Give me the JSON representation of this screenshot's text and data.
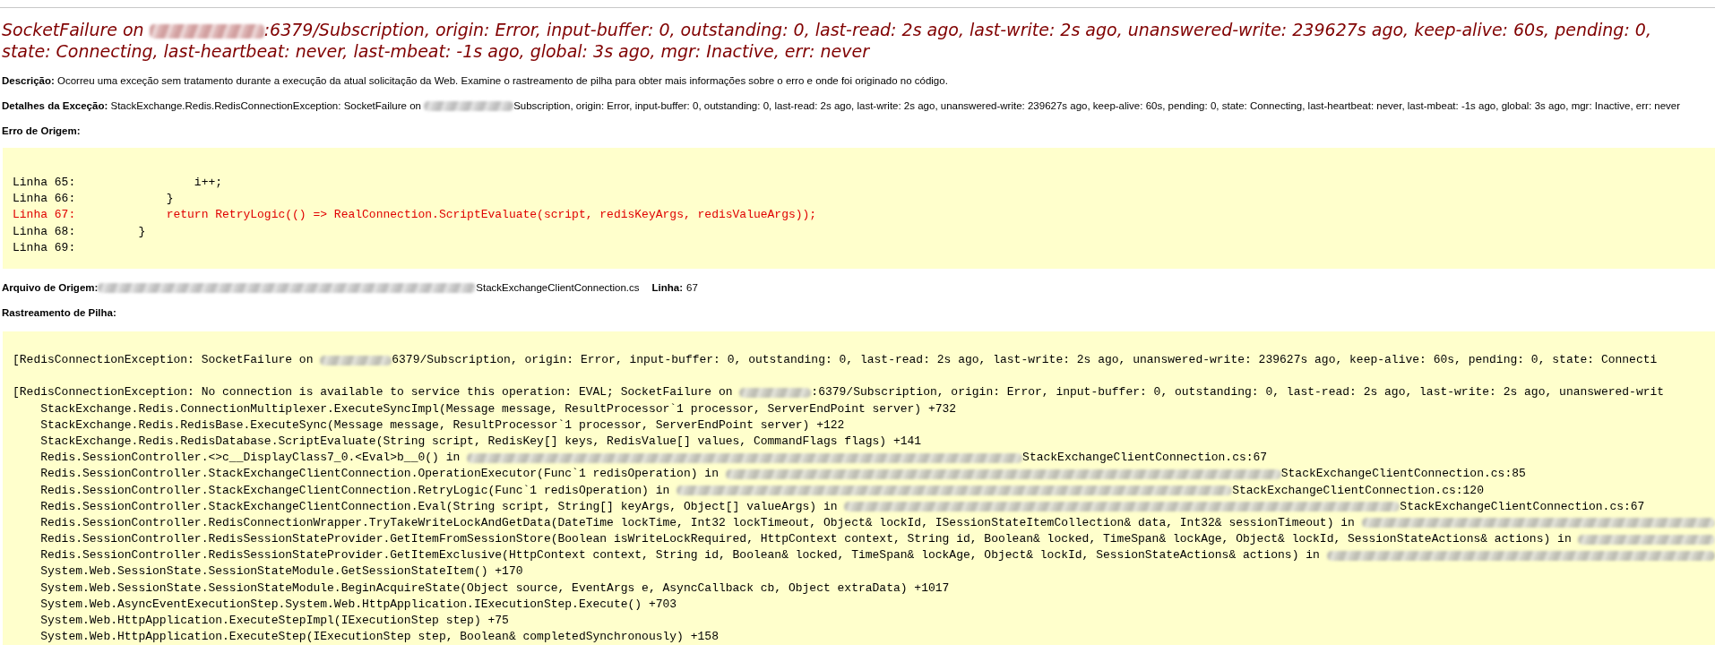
{
  "title": {
    "parts": [
      {
        "kind": "text",
        "text": "SocketFailure on "
      },
      {
        "kind": "redacted"
      },
      {
        "kind": "text",
        "text": ":6379/Subscription, origin: Error, input-buffer: 0, outstanding: 0, last-read: 2s ago, last-write: 2s ago, unanswered-write: 239627s ago, keep-alive: 60s, pending: 0, state: Connecting, last-heartbeat: never, last-mbeat: -1s ago, global: 3s ago, mgr: Inactive, err: never"
      }
    ]
  },
  "description": "**Descrição:** Ocorreu uma exceção sem tratamento durante a execução da atual solicitação da Web. Examine o rastreamento de pilha para obter mais informações sobre o erro e onde foi originado no código.",
  "exception_details": {
    "parts": [
      {
        "kind": "text",
        "text": "**Detalhes da Exceção:** StackExchange.Redis.RedisConnectionException: SocketFailure on "
      },
      {
        "kind": "redacted"
      },
      {
        "kind": "text",
        "text": "Subscription, origin: Error, input-buffer: 0, outstanding: 0, last-read: 2s ago, last-write: 2s ago, unanswered-write: 239627s ago, keep-alive: 60s, pending: 0, state: Connecting, last-heartbeat: never, last-mbeat: -1s ago, global: 3s ago, mgr: Inactive, err: never"
      }
    ]
  },
  "source_error": {
    "label": "Erro de Origem:",
    "lines": [
      {
        "number": "Linha 65:",
        "code": "                 i++;",
        "error": false
      },
      {
        "number": "Linha 66:",
        "code": "             }",
        "error": false
      },
      {
        "number": "Linha 67:",
        "code": "             return RetryLogic(() => RealConnection.ScriptEvaluate(script, redisKeyArgs, redisValueArgs));",
        "error": true
      },
      {
        "number": "Linha 68:",
        "code": "         }",
        "error": false
      },
      {
        "number": "Linha 69:",
        "error": false
      }
    ]
  },
  "source_file": {
    "label": "Arquivo de Origem:",
    "parts": [
      {
        "kind": "redacted-medium"
      },
      {
        "kind": "text",
        "text": "StackExchangeClientConnection.cs"
      }
    ],
    "line_label": "Linha:",
    "line": "67"
  },
  "stack_trace": {
    "label": "Rastreamento de Pilha:",
    "groups": [
      {
        "header": [
          {
            "kind": "text",
            "text": "[RedisConnectionException: SocketFailure on "
          },
          {
            "kind": "redacted"
          },
          {
            "kind": "text",
            "text": "6379/Subscription, origin: Error, input-buffer: 0, outstanding: 0, last-read: 2s ago, last-write: 2s ago, unanswered-write: 239627s ago, keep-alive: 60s, pending: 0, state: Connecti"
          }
        ]
      },
      {
        "header": [
          {
            "kind": "text",
            "text": "[RedisConnectionException: No connection is available to service this operation: EVAL; SocketFailure on "
          },
          {
            "kind": "redacted"
          },
          {
            "kind": "text",
            "text": ":6379/Subscription, origin: Error, input-buffer: 0, outstanding: 0, last-read: 2s ago, last-write: 2s ago, unanswered-writ"
          }
        ],
        "frames": [
          [
            {
              "kind": "text",
              "text": "StackExchange.Redis.ConnectionMultiplexer.ExecuteSyncImpl(Message message, ResultProcessor`1 processor, ServerEndPoint server) +732"
            }
          ],
          [
            {
              "kind": "text",
              "text": "StackExchange.Redis.RedisBase.ExecuteSync(Message message, ResultProcessor`1 processor, ServerEndPoint server) +122"
            }
          ],
          [
            {
              "kind": "text",
              "text": "StackExchange.Redis.RedisDatabase.ScriptEvaluate(String script, RedisKey[] keys, RedisValue[] values, CommandFlags flags) +141"
            }
          ],
          [
            {
              "kind": "text",
              "text": "Redis.SessionController.<>c__DisplayClass7_0.<Eval>b__0() in "
            },
            {
              "kind": "redacted-wide"
            },
            {
              "kind": "text",
              "text": "StackExchangeClientConnection.cs:67"
            }
          ],
          [
            {
              "kind": "text",
              "text": "Redis.SessionController.StackExchangeClientConnection.OperationExecutor(Func`1 redisOperation) in "
            },
            {
              "kind": "redacted-wide"
            },
            {
              "kind": "text",
              "text": "StackExchangeClientConnection.cs:85"
            }
          ],
          [
            {
              "kind": "text",
              "text": "Redis.SessionController.StackExchangeClientConnection.RetryLogic(Func`1 redisOperation) in "
            },
            {
              "kind": "redacted-wide"
            },
            {
              "kind": "text",
              "text": "StackExchangeClientConnection.cs:120"
            }
          ],
          [
            {
              "kind": "text",
              "text": "Redis.SessionController.StackExchangeClientConnection.Eval(String script, String[] keyArgs, Object[] valueArgs) in "
            },
            {
              "kind": "redacted-wide"
            },
            {
              "kind": "text",
              "text": "StackExchangeClientConnection.cs:67"
            }
          ],
          [
            {
              "kind": "text",
              "text": "Redis.SessionController.RedisConnectionWrapper.TryTakeWriteLockAndGetData(DateTime lockTime, Int32 lockTimeout, Object& lockId, ISessionStateItemCollection& data, Int32& sessionTimeout) in "
            },
            {
              "kind": "redacted"
            }
          ],
          [
            {
              "kind": "text",
              "text": "Redis.SessionController.RedisSessionStateProvider.GetItemFromSessionStore(Boolean isWriteLockRequired, HttpContext context, String id, Boolean& locked, TimeSpan& lockAge, Object& lockId, SessionStateActions& actions) in "
            },
            {
              "kind": "redacted"
            }
          ],
          [
            {
              "kind": "text",
              "text": "Redis.SessionController.RedisSessionStateProvider.GetItemExclusive(HttpContext context, String id, Boolean& locked, TimeSpan& lockAge, Object& lockId, SessionStateActions& actions) in "
            },
            {
              "kind": "redacted"
            }
          ],
          [
            {
              "kind": "text",
              "text": "System.Web.SessionState.SessionStateModule.GetSessionStateItem() +170"
            }
          ],
          [
            {
              "kind": "text",
              "text": "System.Web.SessionState.SessionStateModule.BeginAcquireState(Object source, EventArgs e, AsyncCallback cb, Object extraData) +1017"
            }
          ],
          [
            {
              "kind": "text",
              "text": "System.Web.AsyncEventExecutionStep.System.Web.HttpApplication.IExecutionStep.Execute() +703"
            }
          ],
          [
            {
              "kind": "text",
              "text": "System.Web.HttpApplication.ExecuteStepImpl(IExecutionStep step) +75"
            }
          ],
          [
            {
              "kind": "text",
              "text": "System.Web.HttpApplication.ExecuteStep(IExecutionStep step, Boolean& completedSynchronously) +158"
            }
          ]
        ]
      }
    ]
  }
}
